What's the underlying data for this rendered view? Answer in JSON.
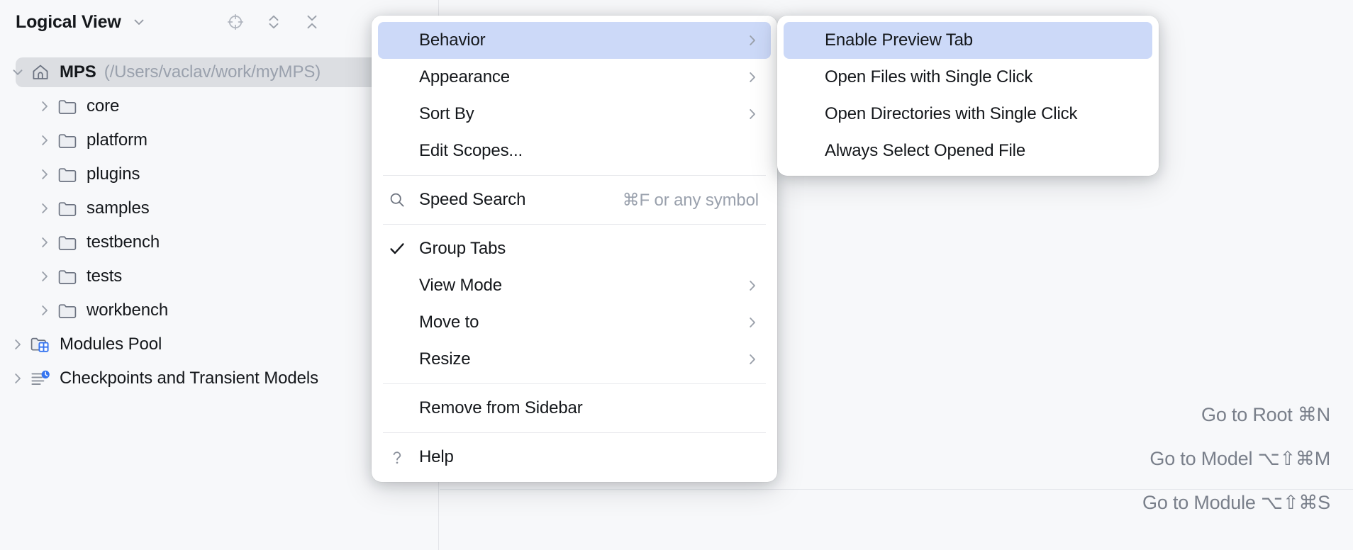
{
  "tool_window": {
    "title": "Logical View",
    "title_chevron_icon": "chevron-down-icon",
    "actions": [
      {
        "name": "scroll-from-source-icon",
        "label": "Select Opened File"
      },
      {
        "name": "expand-all-icon",
        "label": "Expand All"
      },
      {
        "name": "collapse-all-icon",
        "label": "Collapse All"
      }
    ],
    "tree": [
      {
        "label": "MPS",
        "path": "(/Users/vaclav/work/myMPS)",
        "icon": "home-icon",
        "twisty": "chevron-down-icon",
        "indent": 0,
        "selected": true,
        "bold": true
      },
      {
        "label": "core",
        "icon": "folder-icon",
        "twisty": "chevron-right-icon",
        "indent": 1,
        "selected": false,
        "bold": false
      },
      {
        "label": "platform",
        "icon": "folder-icon",
        "twisty": "chevron-right-icon",
        "indent": 1,
        "selected": false,
        "bold": false
      },
      {
        "label": "plugins",
        "icon": "folder-icon",
        "twisty": "chevron-right-icon",
        "indent": 1,
        "selected": false,
        "bold": false
      },
      {
        "label": "samples",
        "icon": "folder-icon",
        "twisty": "chevron-right-icon",
        "indent": 1,
        "selected": false,
        "bold": false
      },
      {
        "label": "testbench",
        "icon": "folder-icon",
        "twisty": "chevron-right-icon",
        "indent": 1,
        "selected": false,
        "bold": false
      },
      {
        "label": "tests",
        "icon": "folder-icon",
        "twisty": "chevron-right-icon",
        "indent": 1,
        "selected": false,
        "bold": false
      },
      {
        "label": "workbench",
        "icon": "folder-icon",
        "twisty": "chevron-right-icon",
        "indent": 1,
        "selected": false,
        "bold": false
      },
      {
        "label": "Modules Pool",
        "icon": "modules-pool-icon",
        "twisty": "chevron-right-icon",
        "indent": 0,
        "selected": false,
        "bold": false
      },
      {
        "label": "Checkpoints and Transient Models",
        "icon": "checkpoints-icon",
        "twisty": "chevron-right-icon",
        "indent": 0,
        "selected": false,
        "bold": false
      }
    ]
  },
  "context_menu": {
    "items": [
      {
        "label": "Behavior",
        "type": "submenu",
        "highlighted": true,
        "gutter_icon": "",
        "arrow_icon": "chevron-right-icon",
        "shortcut": ""
      },
      {
        "label": "Appearance",
        "type": "submenu",
        "highlighted": false,
        "gutter_icon": "",
        "arrow_icon": "chevron-right-icon",
        "shortcut": ""
      },
      {
        "label": "Sort By",
        "type": "submenu",
        "highlighted": false,
        "gutter_icon": "",
        "arrow_icon": "chevron-right-icon",
        "shortcut": ""
      },
      {
        "label": "Edit Scopes...",
        "type": "action",
        "highlighted": false,
        "gutter_icon": "",
        "arrow_icon": "",
        "shortcut": ""
      },
      {
        "type": "separator"
      },
      {
        "label": "Speed Search",
        "type": "action",
        "highlighted": false,
        "gutter_icon": "search-icon",
        "arrow_icon": "",
        "shortcut": "⌘F or any symbol"
      },
      {
        "type": "separator"
      },
      {
        "label": "Group Tabs",
        "type": "checkbox",
        "highlighted": false,
        "gutter_icon": "check-icon",
        "arrow_icon": "",
        "shortcut": "",
        "checked": true
      },
      {
        "label": "View Mode",
        "type": "submenu",
        "highlighted": false,
        "gutter_icon": "",
        "arrow_icon": "chevron-right-icon",
        "shortcut": ""
      },
      {
        "label": "Move to",
        "type": "submenu",
        "highlighted": false,
        "gutter_icon": "",
        "arrow_icon": "chevron-right-icon",
        "shortcut": ""
      },
      {
        "label": "Resize",
        "type": "submenu",
        "highlighted": false,
        "gutter_icon": "",
        "arrow_icon": "chevron-right-icon",
        "shortcut": ""
      },
      {
        "type": "separator"
      },
      {
        "label": "Remove from Sidebar",
        "type": "action",
        "highlighted": false,
        "gutter_icon": "",
        "arrow_icon": "",
        "shortcut": ""
      },
      {
        "type": "separator"
      },
      {
        "label": "Help",
        "type": "action",
        "highlighted": false,
        "gutter_icon": "question-icon",
        "arrow_icon": "",
        "shortcut": ""
      }
    ]
  },
  "submenu": {
    "parent": "Behavior",
    "items": [
      {
        "label": "Enable Preview Tab",
        "highlighted": true
      },
      {
        "label": "Open Files with Single Click",
        "highlighted": false
      },
      {
        "label": "Open Directories with Single Click",
        "highlighted": false
      },
      {
        "label": "Always Select Opened File",
        "highlighted": false
      }
    ]
  },
  "editor_hints": {
    "lines": [
      "Go to Root ⌘N",
      "Go to Model ⌥⇧⌘M",
      "Go to Module ⌥⇧⌘S"
    ]
  },
  "colors": {
    "window_background": "#f7f8fa",
    "menu_background": "#ffffff",
    "menu_highlight": "#ccd9f8",
    "tree_selection": "#dcdee2",
    "text_primary": "#14171b",
    "text_secondary": "#9aa1ad",
    "hint_text": "#797f8a",
    "accent_blue": "#3574f0",
    "divider": "#e3e5e9"
  }
}
